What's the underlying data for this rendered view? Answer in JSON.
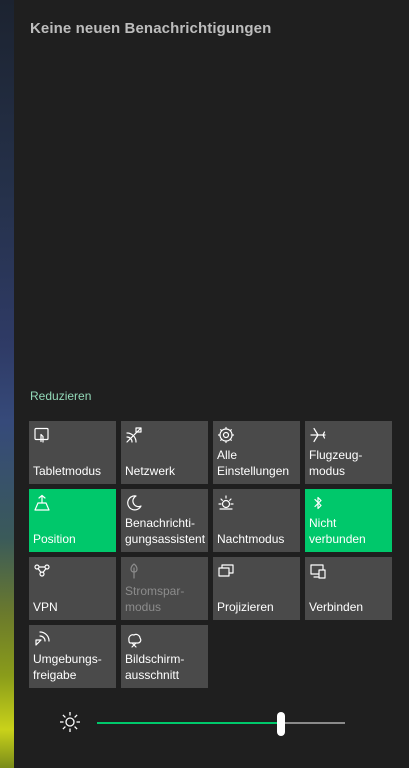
{
  "header": {
    "no_notifications": "Keine neuen Benachrichtigungen"
  },
  "collapse_label": "Reduzieren",
  "colors": {
    "accent": "#00c86b",
    "tile": "#4a4a4a",
    "background": "#1f1f1f"
  },
  "tiles": [
    {
      "label": "Tabletmodus",
      "icon": "tablet-mode-icon",
      "active": false,
      "disabled": false
    },
    {
      "label": "Netzwerk",
      "icon": "network-icon",
      "active": false,
      "disabled": false
    },
    {
      "label": "Alle\nEinstellungen",
      "icon": "gear-icon",
      "active": false,
      "disabled": false
    },
    {
      "label": "Flugzeug-\nmodus",
      "icon": "airplane-icon",
      "active": false,
      "disabled": false
    },
    {
      "label": "Position",
      "icon": "location-icon",
      "active": true,
      "disabled": false
    },
    {
      "label": "Benachrichti-\ngungsassistent",
      "icon": "moon-icon",
      "active": false,
      "disabled": false
    },
    {
      "label": "Nachtmodus",
      "icon": "night-light-icon",
      "active": false,
      "disabled": false
    },
    {
      "label": "Nicht\nverbunden",
      "icon": "bluetooth-icon",
      "active": true,
      "disabled": false
    },
    {
      "label": "VPN",
      "icon": "vpn-icon",
      "active": false,
      "disabled": false
    },
    {
      "label": "Stromspar-\nmodus",
      "icon": "battery-saver-icon",
      "active": false,
      "disabled": true
    },
    {
      "label": "Projizieren",
      "icon": "project-icon",
      "active": false,
      "disabled": false
    },
    {
      "label": "Verbinden",
      "icon": "connect-icon",
      "active": false,
      "disabled": false
    },
    {
      "label": "Umgebungs-\nfreigabe",
      "icon": "nearby-sharing-icon",
      "active": false,
      "disabled": false
    },
    {
      "label": "Bildschirm-\nausschnitt",
      "icon": "screen-snip-icon",
      "active": false,
      "disabled": false
    }
  ],
  "brightness": {
    "icon": "brightness-icon",
    "level": 0.74
  }
}
